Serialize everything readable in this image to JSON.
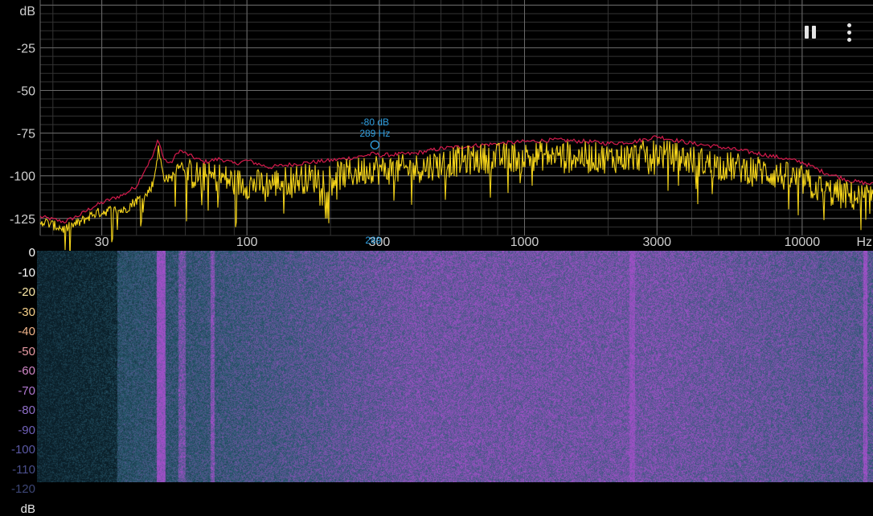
{
  "app": {
    "pause_icon": "pause-icon",
    "menu_icon": "more-vert-icon"
  },
  "colors": {
    "background": "#000000",
    "live_spectrum": "#f2d21a",
    "peak_hold": "#d41a4c",
    "marker": "#2f9fe0",
    "grid_major": "#6a6a6a",
    "grid_minor": "#333333"
  },
  "chart_data": {
    "type": "line",
    "x_scale": "log",
    "y_unit_label": "dB",
    "x_unit_label": "Hz",
    "ylim": [
      -135,
      3
    ],
    "xlim": [
      18,
      18000
    ],
    "y_ticks": [
      "-25",
      "-50",
      "-75",
      "-100",
      "-125"
    ],
    "y_tick_values": [
      -25,
      -50,
      -75,
      -100,
      -125
    ],
    "x_ticks": [
      "30",
      "100",
      "300",
      "1000",
      "3000",
      "10000"
    ],
    "x_tick_values": [
      30,
      100,
      300,
      1000,
      3000,
      10000
    ],
    "grid": true,
    "series": [
      {
        "key": "peak",
        "x": [
          18,
          22,
          25,
          28,
          32,
          36,
          40,
          43,
          46,
          48,
          50,
          53,
          57,
          62,
          70,
          80,
          90,
          100,
          120,
          150,
          200,
          250,
          289,
          300,
          400,
          500,
          700,
          1000,
          1300,
          1700,
          2000,
          2500,
          3000,
          4000,
          5000,
          7000,
          10000,
          12000,
          15000,
          18000
        ],
        "y": [
          -124,
          -127,
          -123,
          -118,
          -114,
          -111,
          -106,
          -96,
          -88,
          -78,
          -90,
          -93,
          -85,
          -88,
          -92,
          -90,
          -93,
          -91,
          -95,
          -93,
          -91,
          -89,
          -87,
          -88,
          -87,
          -84,
          -82,
          -80,
          -79,
          -80,
          -81,
          -80,
          -77,
          -81,
          -83,
          -87,
          -92,
          -98,
          -103,
          -105
        ]
      },
      {
        "key": "live",
        "x": [
          18,
          22,
          25,
          28,
          32,
          36,
          40,
          43,
          46,
          48,
          50,
          53,
          57,
          62,
          70,
          80,
          90,
          100,
          120,
          150,
          200,
          250,
          289,
          300,
          400,
          500,
          700,
          1000,
          1300,
          1700,
          2000,
          2500,
          3000,
          4000,
          5000,
          7000,
          10000,
          12000,
          15000,
          18000
        ],
        "y": [
          -126,
          -131,
          -127,
          -122,
          -120,
          -120,
          -114,
          -112,
          -104,
          -84,
          -100,
          -102,
          -92,
          -98,
          -100,
          -100,
          -103,
          -104,
          -104,
          -101,
          -100,
          -97,
          -94,
          -96,
          -95,
          -92,
          -89,
          -88,
          -87,
          -88,
          -89,
          -88,
          -86,
          -90,
          -93,
          -96,
          -102,
          -108,
          -111,
          -113
        ]
      }
    ],
    "marker": {
      "frequency": 289,
      "level": -80,
      "label_db": "-80 dB",
      "label_hz": "289 Hz",
      "axis_label": "289"
    }
  },
  "waterfall": {
    "scale_labels": [
      "0",
      "-10",
      "-20",
      "-30",
      "-40",
      "-50",
      "-60",
      "-70",
      "-80",
      "-90",
      "-100",
      "-110",
      "-120",
      "dB"
    ],
    "scale_values": [
      0,
      -10,
      -20,
      -30,
      -40,
      -50,
      -60,
      -70,
      -80,
      -90,
      -100,
      -110,
      -120
    ],
    "scale_colors": [
      "#ffffff",
      "#ffffff",
      "#fbe9a8",
      "#f6d08a",
      "#f0b48a",
      "#e79aa4",
      "#cf86c6",
      "#b078d0",
      "#8f6ec8",
      "#6f60b8",
      "#5a58a4",
      "#4a4f8c",
      "#3d4676"
    ]
  }
}
